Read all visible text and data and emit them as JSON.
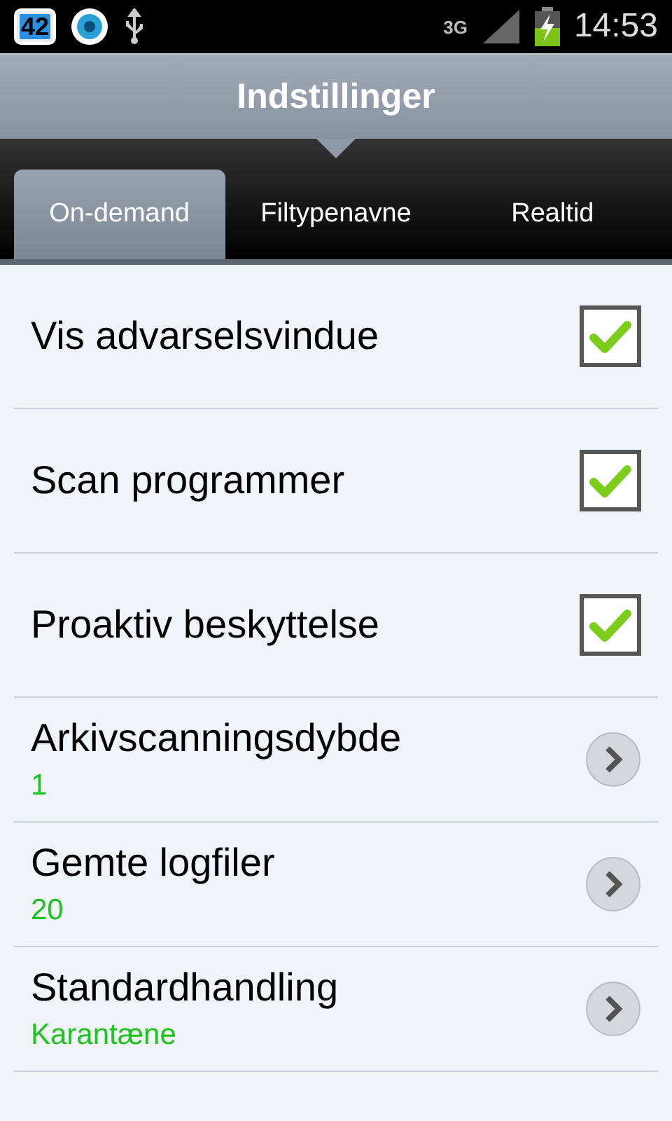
{
  "status_bar": {
    "notification_count": "42",
    "network": "3G",
    "time": "14:53"
  },
  "header": {
    "title": "Indstillinger"
  },
  "tabs": [
    {
      "label": "On-demand",
      "selected": true
    },
    {
      "label": "Filtypenavne",
      "selected": false
    },
    {
      "label": "Realtid",
      "selected": false
    }
  ],
  "settings": [
    {
      "kind": "checkbox",
      "label": "Vis advarselsvindue",
      "checked": true
    },
    {
      "kind": "checkbox",
      "label": "Scan programmer",
      "checked": true
    },
    {
      "kind": "checkbox",
      "label": "Proaktiv beskyttelse",
      "checked": true
    },
    {
      "kind": "link",
      "label": "Arkivscanningsdybde",
      "value": "1"
    },
    {
      "kind": "link",
      "label": "Gemte logfiler",
      "value": "20"
    },
    {
      "kind": "link",
      "label": "Standardhandling",
      "value": "Karantæne"
    }
  ]
}
